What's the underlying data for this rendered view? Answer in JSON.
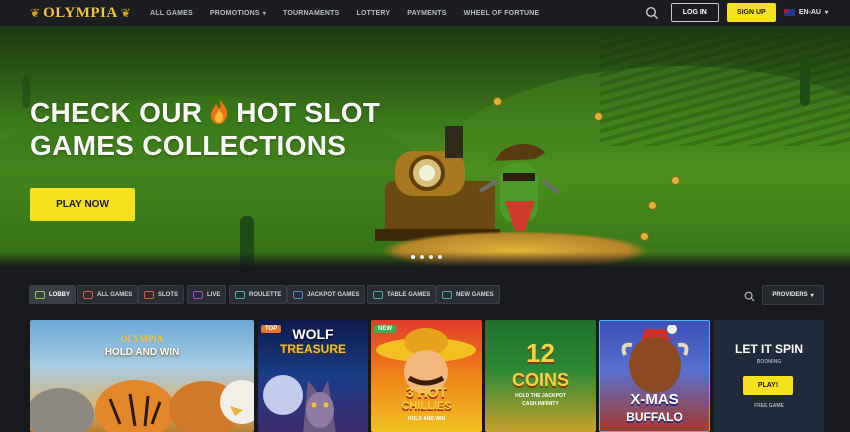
{
  "brand": {
    "name": "OLYMPIA",
    "accent": "#f7e11c",
    "gold": "#f3c43a"
  },
  "nav": {
    "links": [
      {
        "label": "ALL GAMES"
      },
      {
        "label": "PROMOTIONS",
        "dropdown": true
      },
      {
        "label": "TOURNAMENTS"
      },
      {
        "label": "LOTTERY"
      },
      {
        "label": "PAYMENTS"
      },
      {
        "label": "WHEEL OF FORTUNE"
      }
    ],
    "login_label": "LOG IN",
    "signup_label": "SIGN UP",
    "language": "EN-AU",
    "search_icon": "search-icon"
  },
  "hero": {
    "title_line1_a": "CHECK OUR",
    "title_line1_b": "HOT SLOT",
    "title_line2": "GAMES COLLECTIONS",
    "cta_label": "PLAY NOW",
    "slides_total": 4,
    "active_slide": 1
  },
  "categories": [
    {
      "label": "LOBBY",
      "icon": "lobby-icon",
      "color": "#7bd14b",
      "active": true
    },
    {
      "label": "ALL GAMES",
      "icon": "all-games-icon",
      "color": "#e35a4b"
    },
    {
      "label": "SLOTS",
      "icon": "slots-icon",
      "color": "#e35a4b"
    },
    {
      "label": "LIVE",
      "icon": "live-icon",
      "color": "#a04be3"
    },
    {
      "label": "ROULETTE",
      "icon": "roulette-icon",
      "color": "#3fb8b2"
    },
    {
      "label": "JACKPOT GAMES",
      "icon": "jackpot-icon",
      "color": "#4b8fe3"
    },
    {
      "label": "TABLE GAMES",
      "icon": "table-games-icon",
      "color": "#3fb8b2"
    },
    {
      "label": "NEW GAMES",
      "icon": "new-games-icon",
      "color": "#3fb8b2"
    }
  ],
  "providers_label": "PROVIDERS",
  "games": [
    {
      "title_top": "OLYMPIA",
      "title": "HOLD AND WIN"
    },
    {
      "badge": "TOP",
      "title_a": "WOLF",
      "title_b": "TREASURE"
    },
    {
      "badge": "NEW",
      "title_a": "3 HOT",
      "title_b": "CHILLIES",
      "sub": "HOLD AND WIN"
    },
    {
      "title_a": "12",
      "title_b": "COINS",
      "sub": "HOLD THE JACKPOT",
      "sub2": "CASH INFINITY"
    },
    {
      "title_a": "X-MAS",
      "title_b": "BUFFALO"
    },
    {
      "title": "LET IT SPIN",
      "provider": "BOOMING",
      "play_label": "PLAY!",
      "free_label": "FREE GAME"
    }
  ]
}
